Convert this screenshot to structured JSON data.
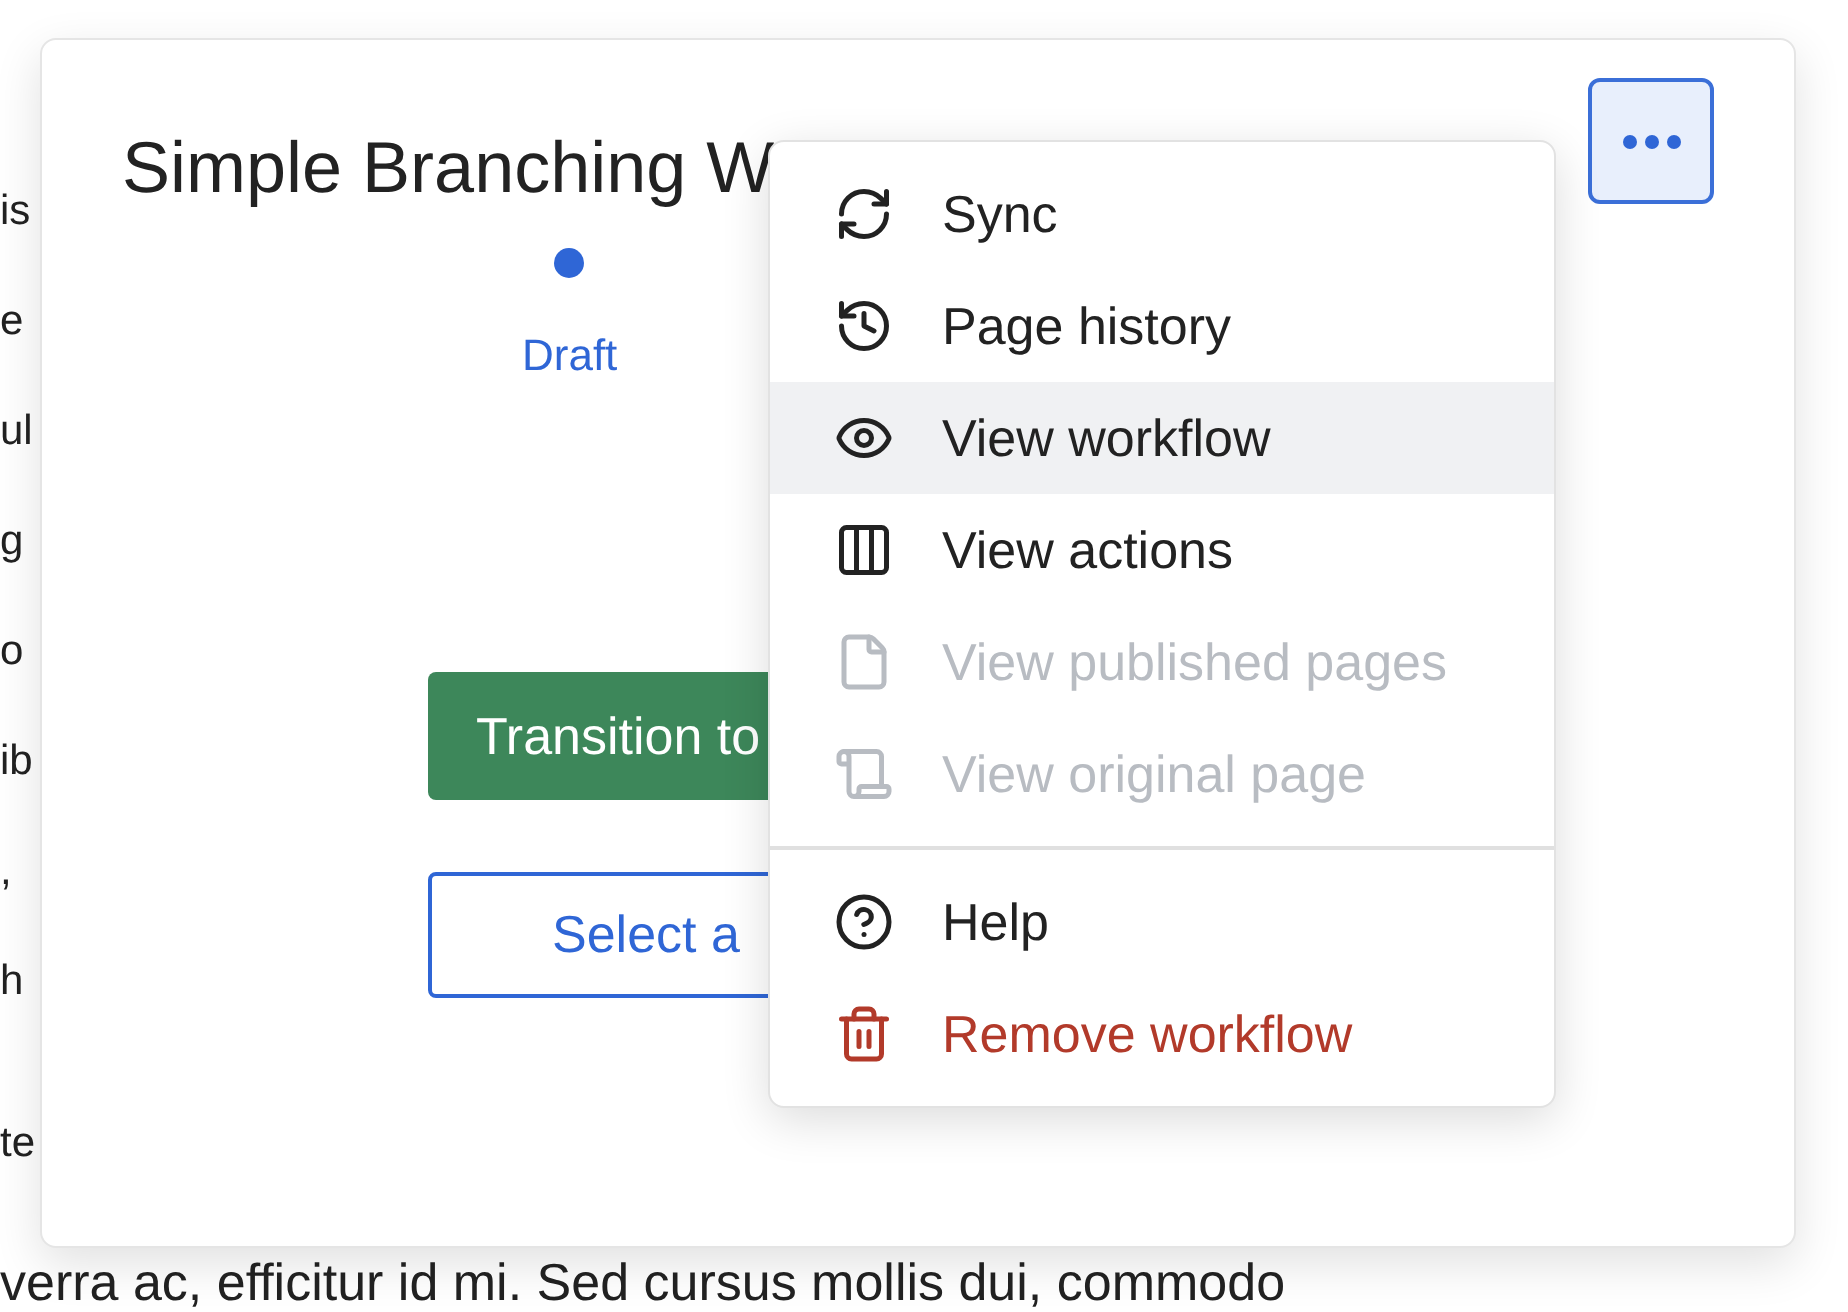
{
  "background_text": {
    "fragments": [
      "is",
      "e",
      "ul",
      "g",
      "o",
      "ib",
      ",",
      "h",
      "te"
    ],
    "bottom_line": "verra ac, efficitur id mi. Sed cursus mollis dui, commodo"
  },
  "dialog": {
    "title": "Simple Branching W",
    "steps": [
      {
        "label": "Draft",
        "selected": true
      }
    ],
    "primary_button": "Transition to",
    "secondary_button": "Select a",
    "menu_button": {
      "expanded": true
    }
  },
  "menu": {
    "sections": [
      [
        {
          "label": "Sync",
          "kind": "sync",
          "disabled": false,
          "selected": false,
          "danger": false
        },
        {
          "label": "Page history",
          "kind": "history",
          "disabled": false,
          "selected": false,
          "danger": false
        },
        {
          "label": "View workflow",
          "kind": "eye",
          "disabled": false,
          "selected": true,
          "danger": false
        },
        {
          "label": "View actions",
          "kind": "columns",
          "disabled": false,
          "selected": false,
          "danger": false
        },
        {
          "label": "View published pages",
          "kind": "file",
          "disabled": true,
          "selected": false,
          "danger": false
        },
        {
          "label": "View original page",
          "kind": "scroll",
          "disabled": true,
          "selected": false,
          "danger": false
        }
      ],
      [
        {
          "label": "Help",
          "kind": "help",
          "disabled": false,
          "selected": false,
          "danger": false
        },
        {
          "label": "Remove workflow",
          "kind": "trash",
          "disabled": false,
          "selected": false,
          "danger": true
        }
      ]
    ]
  }
}
